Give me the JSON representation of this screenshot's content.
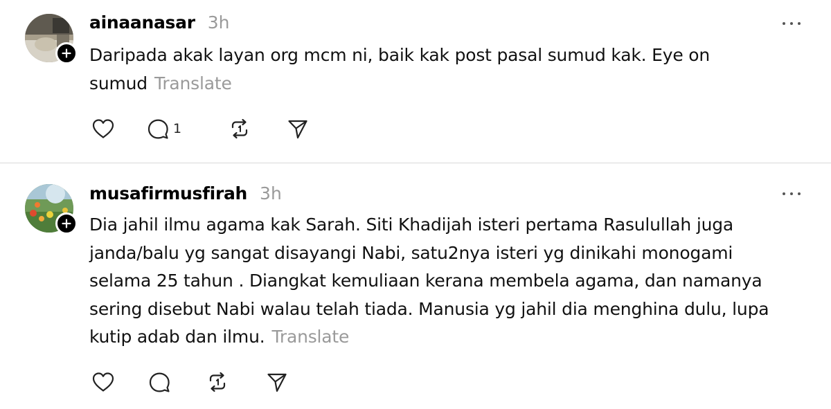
{
  "posts": [
    {
      "username": "ainaanasar",
      "time": "3h",
      "text": "Daripada akak layan org mcm ni, baik kak post pasal sumud kak. Eye on sumud",
      "translate_label": "Translate",
      "reply_count": "1"
    },
    {
      "username": "musafirmusfirah",
      "time": "3h",
      "text": "Dia jahil ilmu agama kak Sarah. Siti Khadijah isteri pertama Rasulullah juga janda/balu yg sangat disayangi Nabi, satu2nya isteri yg dinikahi monogami selama 25 tahun . Diangkat kemuliaan kerana membela agama, dan namanya sering disebut Nabi walau telah tiada. Manusia yg jahil dia menghina dulu, lupa kutip adab dan ilmu.",
      "translate_label": "Translate",
      "reply_count": ""
    }
  ],
  "icons": {
    "like": "heart-icon",
    "reply": "comment-icon",
    "repost": "repost-icon",
    "share": "send-icon",
    "more": "more-dots-icon",
    "follow": "plus-icon"
  },
  "colors": {
    "text": "#000000",
    "muted": "#9a9a9a",
    "divider": "#d9d9d9"
  }
}
